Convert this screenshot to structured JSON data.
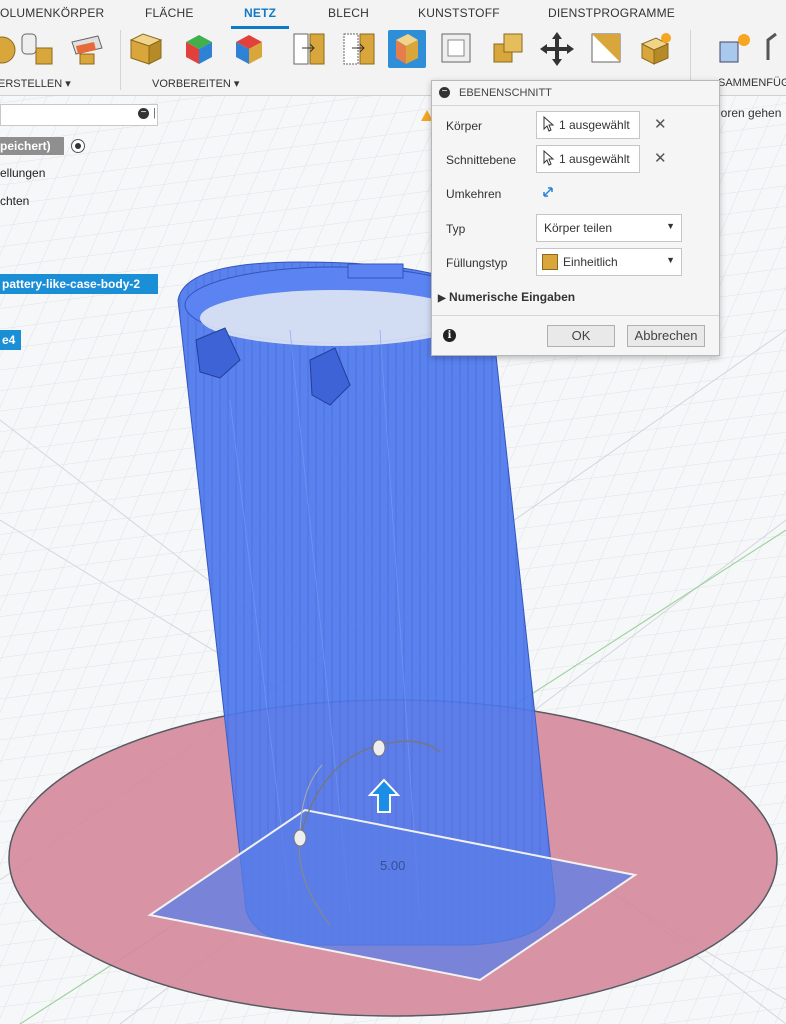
{
  "ribbon": {
    "tabs": [
      "OLUMENKÖRPER",
      "FLÄCHE",
      "NETZ",
      "BLECH",
      "KUNSTSTOFF",
      "DIENSTPROGRAMME"
    ],
    "active_tab": "NETZ",
    "groups": [
      "ERSTELLEN",
      "VORBEREITEN",
      "SAMMENFÜG"
    ]
  },
  "browser": {
    "items": [
      "peichert)",
      "ellungen",
      "chten"
    ],
    "chips": [
      "pattery-like-case-body-2",
      "e4"
    ],
    "chip_color": "#1a8fd6"
  },
  "warning_fragment": "loren gehen",
  "dialog": {
    "title": "EBENENSCHNITT",
    "rows": {
      "body_label": "Körper",
      "body_value": "1 ausgewählt",
      "plane_label": "Schnittebene",
      "plane_value": "1 ausgewählt",
      "flip_label": "Umkehren",
      "type_label": "Typ",
      "type_value": "Körper teilen",
      "fill_label": "Füllungstyp",
      "fill_value": "Einheitlich",
      "numeric_label": "Numerische Eingaben"
    },
    "ok": "OK",
    "cancel": "Abbrechen"
  },
  "viewport": {
    "dimension_value": "5.00",
    "body_color": "#4c78ee",
    "plane_color": "#ee8a8a"
  }
}
